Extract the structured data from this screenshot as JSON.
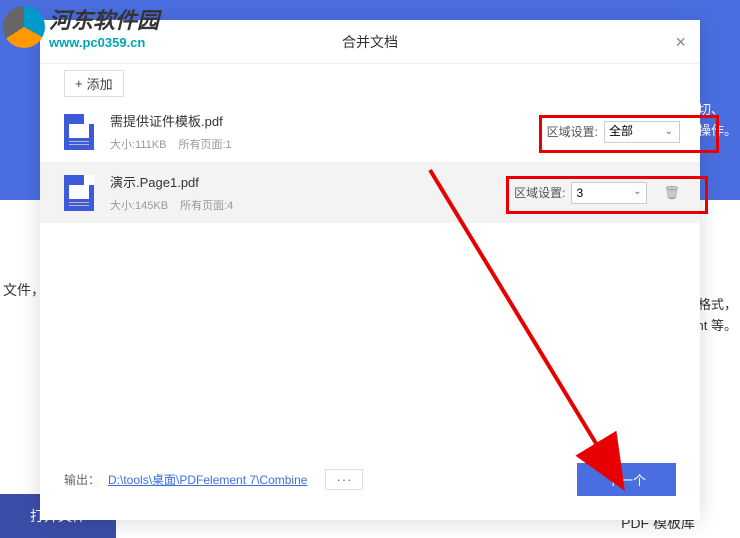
{
  "logo": {
    "title": "河东软件园",
    "url": "www.pc0359.cn"
  },
  "background": {
    "leftText": "文件，点",
    "right1a": "条、剪切、",
    "right1b": "编辑等操作。",
    "right2a": "昌的文档格式，",
    "right2b": "PowerPoint 等。",
    "bottomBtn": "打开文件",
    "bottomLib": "PDF 模板库"
  },
  "dialog": {
    "title": "合并文档",
    "addLabel": "添加",
    "files": [
      {
        "name": "需提供证件模板.pdf",
        "size": "大小:111KB",
        "pages": "所有页面:1",
        "rangeLabel": "区域设置:",
        "rangeValue": "全部"
      },
      {
        "name": "演示.Page1.pdf",
        "size": "大小:145KB",
        "pages": "所有页面:4",
        "rangeLabel": "区域设置:",
        "rangeValue": "3"
      }
    ],
    "outputLabel": "输出：",
    "outputPath": "D:\\tools\\桌面\\PDFelement 7\\Combine",
    "moreLabel": "···",
    "nextLabel": "下一个"
  }
}
